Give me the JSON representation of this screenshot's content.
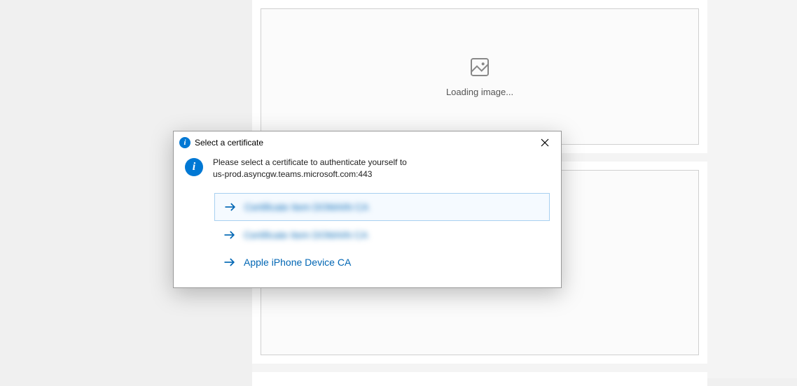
{
  "placeholder": {
    "loading_text": "Loading image..."
  },
  "dialog": {
    "title": "Select a certificate",
    "message_line1": "Please select a certificate to authenticate yourself to",
    "message_line2": "us-prod.asyncgw.teams.microsoft.com:443",
    "certificates": [
      {
        "label": "Certificate Item DOMAIN CA",
        "blurred": true,
        "selected": true
      },
      {
        "label": "Certificate Item DOMAIN CA",
        "blurred": true,
        "selected": false
      },
      {
        "label": "Apple iPhone Device CA",
        "blurred": false,
        "selected": false
      }
    ]
  },
  "colors": {
    "accent": "#0078d4",
    "link": "#0066b4"
  }
}
